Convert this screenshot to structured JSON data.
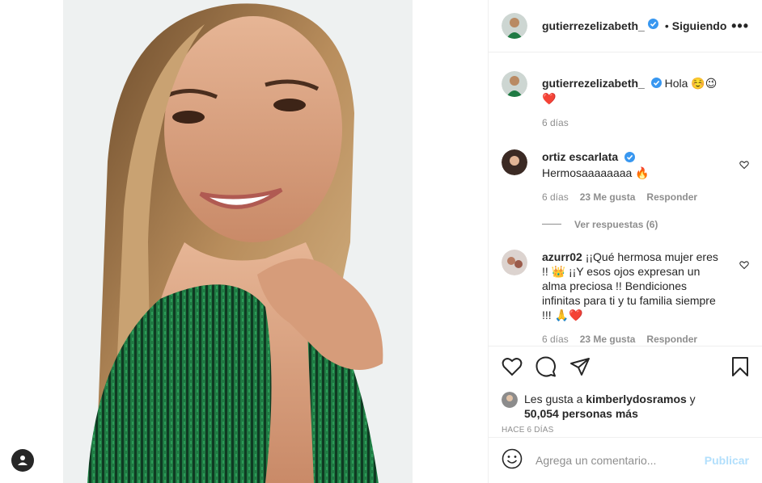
{
  "post": {
    "author": "gutierrezelizabeth_",
    "following_label": "Siguiendo",
    "separator": "•",
    "more_label": "•••"
  },
  "comments": [
    {
      "user": "gutierrezelizabeth_",
      "text": "Hola ☺️😉❤️",
      "time": "6 días"
    },
    {
      "user": "ortiz escarlata",
      "verified": true,
      "text": "Hermosaaaaaaaa 🔥",
      "time": "6 días",
      "likes": "23 Me gusta",
      "reply": "Responder",
      "view_replies": "Ver respuestas (6)"
    },
    {
      "user": "azurr02",
      "text": "¡¡Qué hermosa mujer eres !! 👑 ¡¡Y esos ojos expresan un alma preciosa !! Bendiciones infinitas para ti y tu familia siempre !!! 🙏❤️",
      "time": "6 días",
      "likes": "23 Me gusta",
      "reply": "Responder"
    }
  ],
  "likes": {
    "prefix": "Les gusta a",
    "user": "kimberlydosramos",
    "and": "y",
    "others": "50,054 personas más"
  },
  "time_ago": "HACE 6 DÍAS",
  "comment_box": {
    "placeholder": "Agrega un comentario...",
    "publish": "Publicar"
  },
  "colors": {
    "verified_blue": "#3897f0",
    "publish_disabled": "#b2dffc",
    "sweater_green": "#1e6b3a",
    "heart_red": "#ed4956"
  }
}
